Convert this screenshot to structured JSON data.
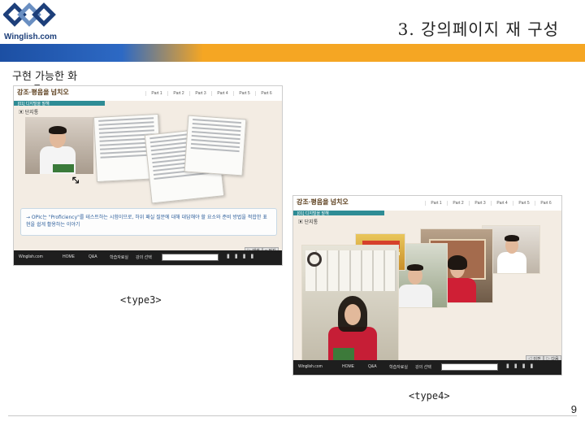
{
  "header": {
    "logo_text": "Winglish.com",
    "title": "3. 강의페이지 재 구성"
  },
  "subtitle": "구현 가능한 화",
  "subtitle_arrow": "⇁",
  "screens": [
    {
      "brand": "강조·평음을 넘치오",
      "tabs": [
        "Part 1",
        "Part 2",
        "Part 3",
        "Part 4",
        "Part 5",
        "Part 6"
      ],
      "teal_text": "[01] 디지털을 말해",
      "sub_label": "▣ 단지통",
      "info_text": "→ OPIc는 \"Proficiency\"를 테스트하는 시험이므로, 하위 패실 질문에 대해 대답해야 할 요소와 준비 방법을 적합한 표현을 쉽게 활용하는 이야기",
      "bottom_items": [
        "Winglish.com",
        "HOME",
        "Q&A",
        "학습자료실",
        "강의 선택"
      ],
      "controls": [
        "▷ 재생",
        "□ 정지"
      ]
    },
    {
      "brand": "강조·평음을 넘치오",
      "tabs": [
        "Part 1",
        "Part 2",
        "Part 3",
        "Part 4",
        "Part 5",
        "Part 6"
      ],
      "teal_text": "[01] 디지털을 말해",
      "sub_label": "▣ 단지통",
      "bottom_items": [
        "Winglish.com",
        "HOME",
        "Q&A",
        "학습자료실",
        "강의 선택"
      ],
      "controls": [
        "◁ 이전",
        "▷ 다음"
      ]
    }
  ],
  "captions": {
    "type3": "<type3>",
    "type4": "<type4>"
  },
  "page_number": "9",
  "colors": {
    "accent_orange": "#f5a623",
    "accent_blue": "#1c4fa3",
    "teal": "#2e8c95"
  }
}
